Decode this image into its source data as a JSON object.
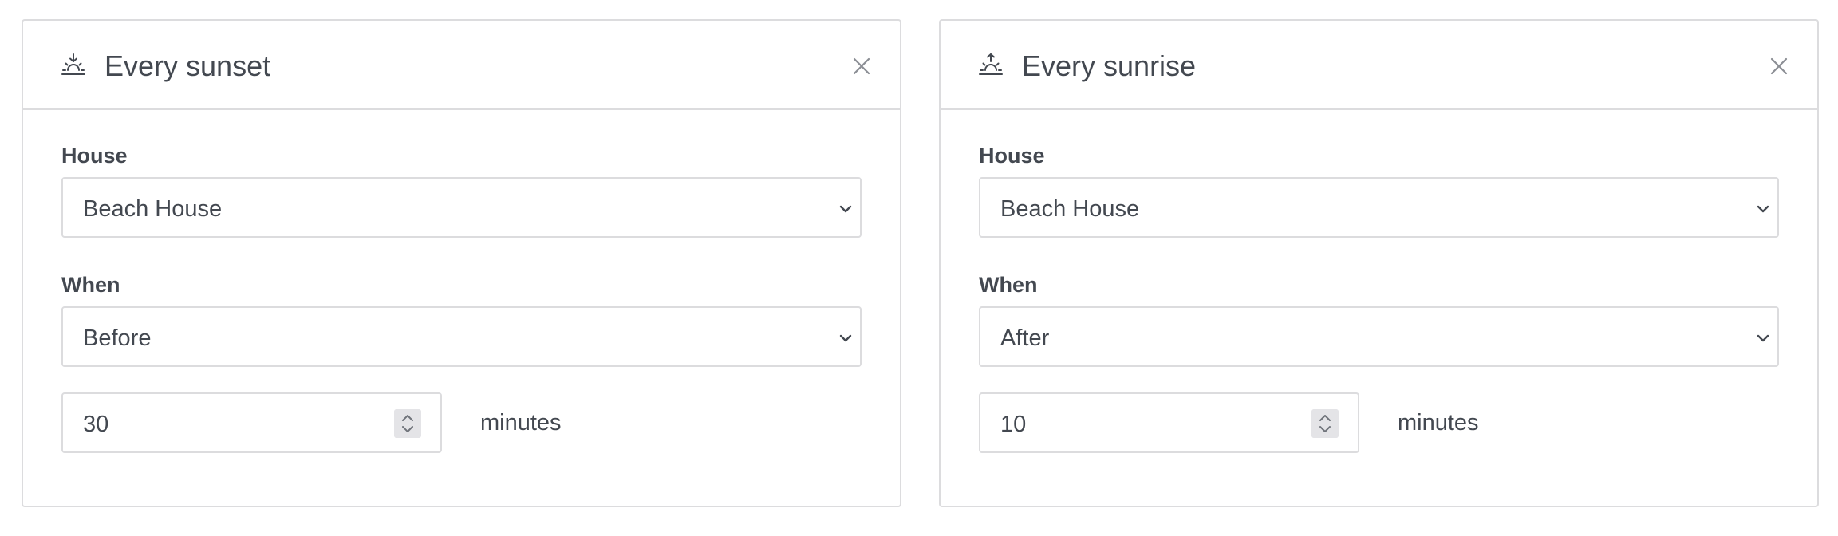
{
  "cards": [
    {
      "title": "Every sunset",
      "icon": "sunset-icon",
      "house_label": "House",
      "house_value": "Beach House",
      "when_label": "When",
      "when_value": "Before",
      "offset_value": "30",
      "offset_unit": "minutes"
    },
    {
      "title": "Every sunrise",
      "icon": "sunrise-icon",
      "house_label": "House",
      "house_value": "Beach House",
      "when_label": "When",
      "when_value": "After",
      "offset_value": "10",
      "offset_unit": "minutes"
    }
  ],
  "colors": {
    "text": "#434850",
    "border": "#dcdcde",
    "icon_muted": "#8b8e94",
    "spinner_bg": "#e4e4e7"
  }
}
